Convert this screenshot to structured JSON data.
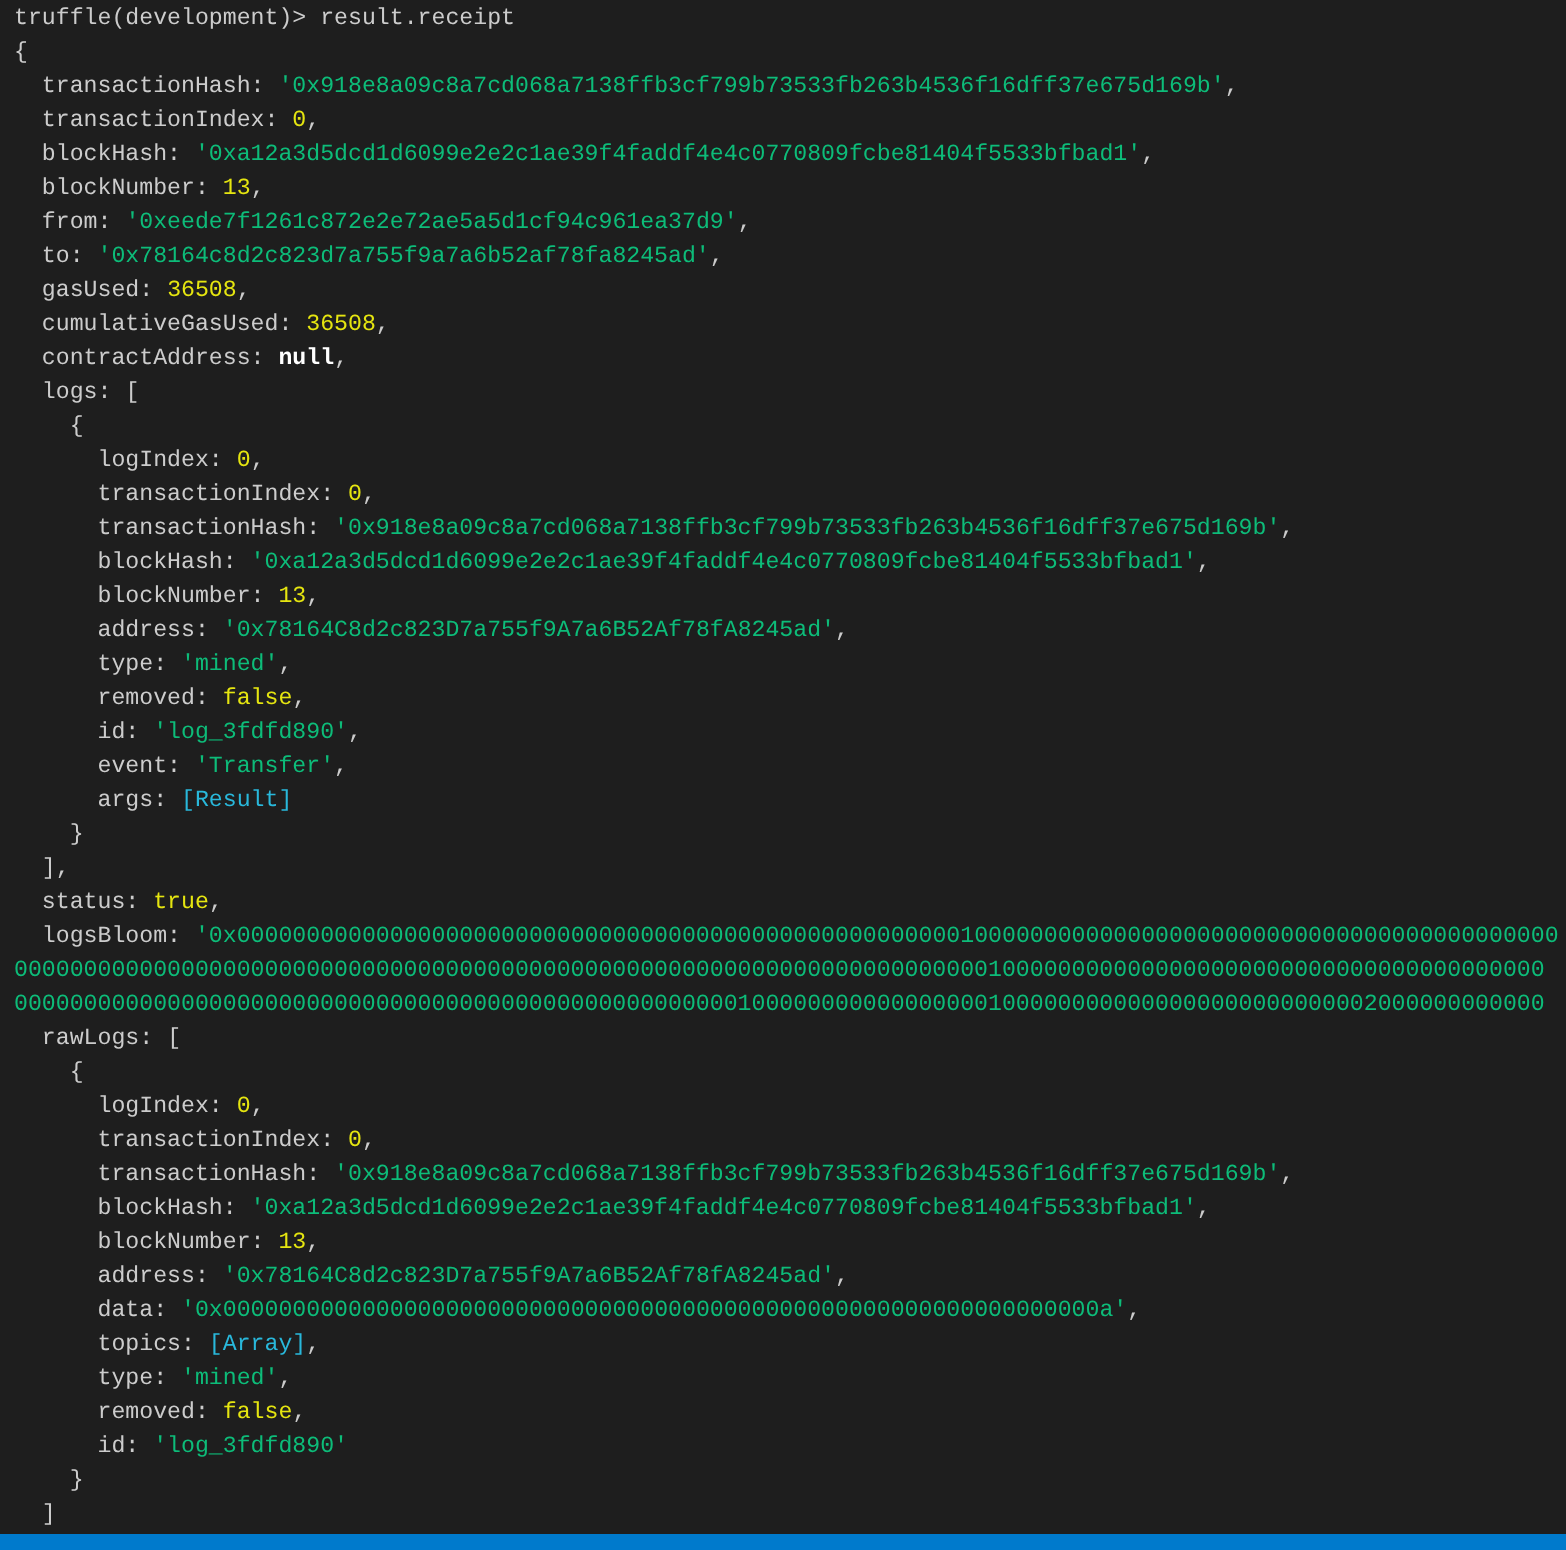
{
  "terminal": {
    "lines": [
      {
        "segments": [
          {
            "kind": "prompt",
            "text": "truffle(development)>"
          },
          {
            "kind": "command",
            "text": "result.receipt"
          }
        ]
      },
      {
        "segments": [
          {
            "kind": "punct",
            "text": "{"
          }
        ]
      },
      {
        "segments": [
          {
            "kind": "key",
            "text": "  transactionHash:"
          },
          {
            "kind": "string",
            "text": "'0x918e8a09c8a7cd068a7138ffb3cf799b73533fb263b4536f16dff37e675d169b'"
          },
          {
            "kind": "punct",
            "text": ","
          }
        ]
      },
      {
        "segments": [
          {
            "kind": "key",
            "text": "  transactionIndex:"
          },
          {
            "kind": "number",
            "text": "0"
          },
          {
            "kind": "punct",
            "text": ","
          }
        ]
      },
      {
        "segments": [
          {
            "kind": "key",
            "text": "  blockHash:"
          },
          {
            "kind": "string",
            "text": "'0xa12a3d5dcd1d6099e2e2c1ae39f4faddf4e4c0770809fcbe81404f5533bfbad1'"
          },
          {
            "kind": "punct",
            "text": ","
          }
        ]
      },
      {
        "segments": [
          {
            "kind": "key",
            "text": "  blockNumber:"
          },
          {
            "kind": "number",
            "text": "13"
          },
          {
            "kind": "punct",
            "text": ","
          }
        ]
      },
      {
        "segments": [
          {
            "kind": "key",
            "text": "  from:"
          },
          {
            "kind": "string",
            "text": "'0xeede7f1261c872e2e72ae5a5d1cf94c961ea37d9'"
          },
          {
            "kind": "punct",
            "text": ","
          }
        ]
      },
      {
        "segments": [
          {
            "kind": "key",
            "text": "  to:"
          },
          {
            "kind": "string",
            "text": "'0x78164c8d2c823d7a755f9a7a6b52af78fa8245ad'"
          },
          {
            "kind": "punct",
            "text": ","
          }
        ]
      },
      {
        "segments": [
          {
            "kind": "key",
            "text": "  gasUsed:"
          },
          {
            "kind": "number",
            "text": "36508"
          },
          {
            "kind": "punct",
            "text": ","
          }
        ]
      },
      {
        "segments": [
          {
            "kind": "key",
            "text": "  cumulativeGasUsed:"
          },
          {
            "kind": "number",
            "text": "36508"
          },
          {
            "kind": "punct",
            "text": ","
          }
        ]
      },
      {
        "segments": [
          {
            "kind": "key",
            "text": "  contractAddress:"
          },
          {
            "kind": "null",
            "text": "null"
          },
          {
            "kind": "punct",
            "text": ","
          }
        ]
      },
      {
        "segments": [
          {
            "kind": "key",
            "text": "  logs:"
          },
          {
            "kind": "punct",
            "text": "["
          }
        ]
      },
      {
        "segments": [
          {
            "kind": "punct",
            "text": "    {"
          }
        ]
      },
      {
        "segments": [
          {
            "kind": "key",
            "text": "      logIndex:"
          },
          {
            "kind": "number",
            "text": "0"
          },
          {
            "kind": "punct",
            "text": ","
          }
        ]
      },
      {
        "segments": [
          {
            "kind": "key",
            "text": "      transactionIndex:"
          },
          {
            "kind": "number",
            "text": "0"
          },
          {
            "kind": "punct",
            "text": ","
          }
        ]
      },
      {
        "segments": [
          {
            "kind": "key",
            "text": "      transactionHash:"
          },
          {
            "kind": "string",
            "text": "'0x918e8a09c8a7cd068a7138ffb3cf799b73533fb263b4536f16dff37e675d169b'"
          },
          {
            "kind": "punct",
            "text": ","
          }
        ]
      },
      {
        "segments": [
          {
            "kind": "key",
            "text": "      blockHash:"
          },
          {
            "kind": "string",
            "text": "'0xa12a3d5dcd1d6099e2e2c1ae39f4faddf4e4c0770809fcbe81404f5533bfbad1'"
          },
          {
            "kind": "punct",
            "text": ","
          }
        ]
      },
      {
        "segments": [
          {
            "kind": "key",
            "text": "      blockNumber:"
          },
          {
            "kind": "number",
            "text": "13"
          },
          {
            "kind": "punct",
            "text": ","
          }
        ]
      },
      {
        "segments": [
          {
            "kind": "key",
            "text": "      address:"
          },
          {
            "kind": "string",
            "text": "'0x78164C8d2c823D7a755f9A7a6B52Af78fA8245ad'"
          },
          {
            "kind": "punct",
            "text": ","
          }
        ]
      },
      {
        "segments": [
          {
            "kind": "key",
            "text": "      type:"
          },
          {
            "kind": "string",
            "text": "'mined'"
          },
          {
            "kind": "punct",
            "text": ","
          }
        ]
      },
      {
        "segments": [
          {
            "kind": "key",
            "text": "      removed:"
          },
          {
            "kind": "boolean",
            "text": "false"
          },
          {
            "kind": "punct",
            "text": ","
          }
        ]
      },
      {
        "segments": [
          {
            "kind": "key",
            "text": "      id:"
          },
          {
            "kind": "string",
            "text": "'log_3fdfd890'"
          },
          {
            "kind": "punct",
            "text": ","
          }
        ]
      },
      {
        "segments": [
          {
            "kind": "key",
            "text": "      event:"
          },
          {
            "kind": "string",
            "text": "'Transfer'"
          },
          {
            "kind": "punct",
            "text": ","
          }
        ]
      },
      {
        "segments": [
          {
            "kind": "key",
            "text": "      args:"
          },
          {
            "kind": "ref",
            "text": "[Result]"
          }
        ]
      },
      {
        "segments": [
          {
            "kind": "punct",
            "text": "    }"
          }
        ]
      },
      {
        "segments": [
          {
            "kind": "punct",
            "text": "  ],"
          }
        ]
      },
      {
        "segments": [
          {
            "kind": "key",
            "text": "  status:"
          },
          {
            "kind": "boolean",
            "text": "true"
          },
          {
            "kind": "punct",
            "text": ","
          }
        ]
      },
      {
        "segments": [
          {
            "kind": "key",
            "text": "  logsBloom:"
          },
          {
            "kind": "string",
            "text": "'0x00000000000000000000000000000000000000000000000000001000000000000000000000000000000000000000000"
          }
        ]
      },
      {
        "segments": [
          {
            "kind": "string",
            "text": "00000000000000000000000000000000000000000000000000000000000000000000001000000000000000000000000000000000000000"
          }
        ]
      },
      {
        "segments": [
          {
            "kind": "string",
            "text": "00000000000000000000000000000000000000000000000000001000000000000000001000000000000000000000000002000000000000"
          }
        ]
      },
      {
        "segments": [
          {
            "kind": "key",
            "text": "  rawLogs:"
          },
          {
            "kind": "punct",
            "text": "["
          }
        ]
      },
      {
        "segments": [
          {
            "kind": "punct",
            "text": "    {"
          }
        ]
      },
      {
        "segments": [
          {
            "kind": "key",
            "text": "      logIndex:"
          },
          {
            "kind": "number",
            "text": "0"
          },
          {
            "kind": "punct",
            "text": ","
          }
        ]
      },
      {
        "segments": [
          {
            "kind": "key",
            "text": "      transactionIndex:"
          },
          {
            "kind": "number",
            "text": "0"
          },
          {
            "kind": "punct",
            "text": ","
          }
        ]
      },
      {
        "segments": [
          {
            "kind": "key",
            "text": "      transactionHash:"
          },
          {
            "kind": "string",
            "text": "'0x918e8a09c8a7cd068a7138ffb3cf799b73533fb263b4536f16dff37e675d169b'"
          },
          {
            "kind": "punct",
            "text": ","
          }
        ]
      },
      {
        "segments": [
          {
            "kind": "key",
            "text": "      blockHash:"
          },
          {
            "kind": "string",
            "text": "'0xa12a3d5dcd1d6099e2e2c1ae39f4faddf4e4c0770809fcbe81404f5533bfbad1'"
          },
          {
            "kind": "punct",
            "text": ","
          }
        ]
      },
      {
        "segments": [
          {
            "kind": "key",
            "text": "      blockNumber:"
          },
          {
            "kind": "number",
            "text": "13"
          },
          {
            "kind": "punct",
            "text": ","
          }
        ]
      },
      {
        "segments": [
          {
            "kind": "key",
            "text": "      address:"
          },
          {
            "kind": "string",
            "text": "'0x78164C8d2c823D7a755f9A7a6B52Af78fA8245ad'"
          },
          {
            "kind": "punct",
            "text": ","
          }
        ]
      },
      {
        "segments": [
          {
            "kind": "key",
            "text": "      data:"
          },
          {
            "kind": "string",
            "text": "'0x000000000000000000000000000000000000000000000000000000000000000a'"
          },
          {
            "kind": "punct",
            "text": ","
          }
        ]
      },
      {
        "segments": [
          {
            "kind": "key",
            "text": "      topics:"
          },
          {
            "kind": "ref",
            "text": "[Array]"
          },
          {
            "kind": "punct",
            "text": ","
          }
        ]
      },
      {
        "segments": [
          {
            "kind": "key",
            "text": "      type:"
          },
          {
            "kind": "string",
            "text": "'mined'"
          },
          {
            "kind": "punct",
            "text": ","
          }
        ]
      },
      {
        "segments": [
          {
            "kind": "key",
            "text": "      removed:"
          },
          {
            "kind": "boolean",
            "text": "false"
          },
          {
            "kind": "punct",
            "text": ","
          }
        ]
      },
      {
        "segments": [
          {
            "kind": "key",
            "text": "      id:"
          },
          {
            "kind": "string",
            "text": "'log_3fdfd890'"
          }
        ]
      },
      {
        "segments": [
          {
            "kind": "punct",
            "text": "    }"
          }
        ]
      },
      {
        "segments": [
          {
            "kind": "punct",
            "text": "  ]"
          }
        ]
      }
    ]
  }
}
